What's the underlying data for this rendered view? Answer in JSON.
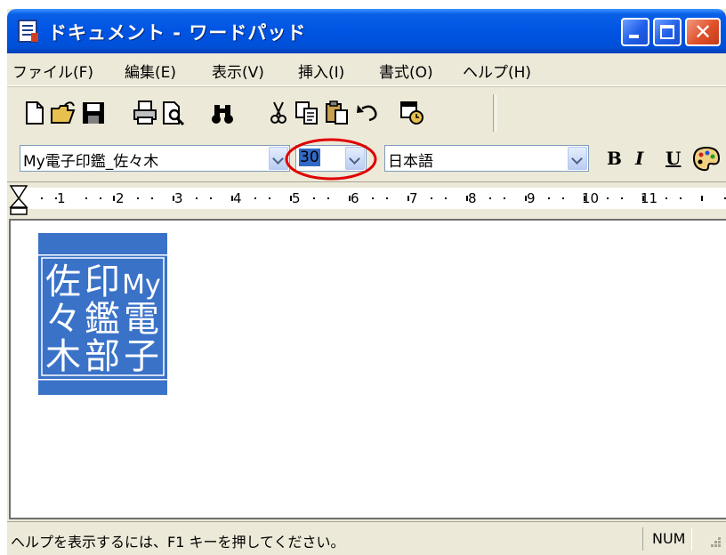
{
  "window": {
    "title": "ドキュメント - ワードパッド"
  },
  "menu": {
    "items": [
      "ファイル(F)",
      "編集(E)",
      "表示(V)",
      "挿入(I)",
      "書式(O)",
      "ヘルプ(H)"
    ]
  },
  "toolbar": {
    "icons": [
      "new-doc-icon",
      "open-folder-icon",
      "save-disk-icon",
      "print-icon",
      "print-preview-icon",
      "find-binoculars-icon",
      "cut-scissors-icon",
      "copy-icon",
      "paste-icon",
      "undo-icon",
      "date-time-icon"
    ]
  },
  "format": {
    "font": "My電子印鑑_佐々木",
    "size": "30",
    "script": "日本語",
    "bold_label": "B",
    "italic_label": "I",
    "underline_label": "U"
  },
  "ruler": {
    "numbers": [
      "1",
      "2",
      "3",
      "4",
      "5",
      "6",
      "7",
      "8",
      "9",
      "10",
      "11"
    ]
  },
  "document": {
    "stamp_lines": [
      [
        "My",
        "電",
        "子"
      ],
      [
        "印",
        "鑑",
        "部"
      ],
      [
        "佐",
        "々",
        "木"
      ]
    ]
  },
  "status": {
    "help_text": "ヘルプを表示するには、F1 キーを押してください。",
    "num_label": "NUM"
  },
  "colors": {
    "accent": "#316ac5",
    "highlight_ring": "#e00000",
    "stamp_blue": "#3a72c8"
  }
}
